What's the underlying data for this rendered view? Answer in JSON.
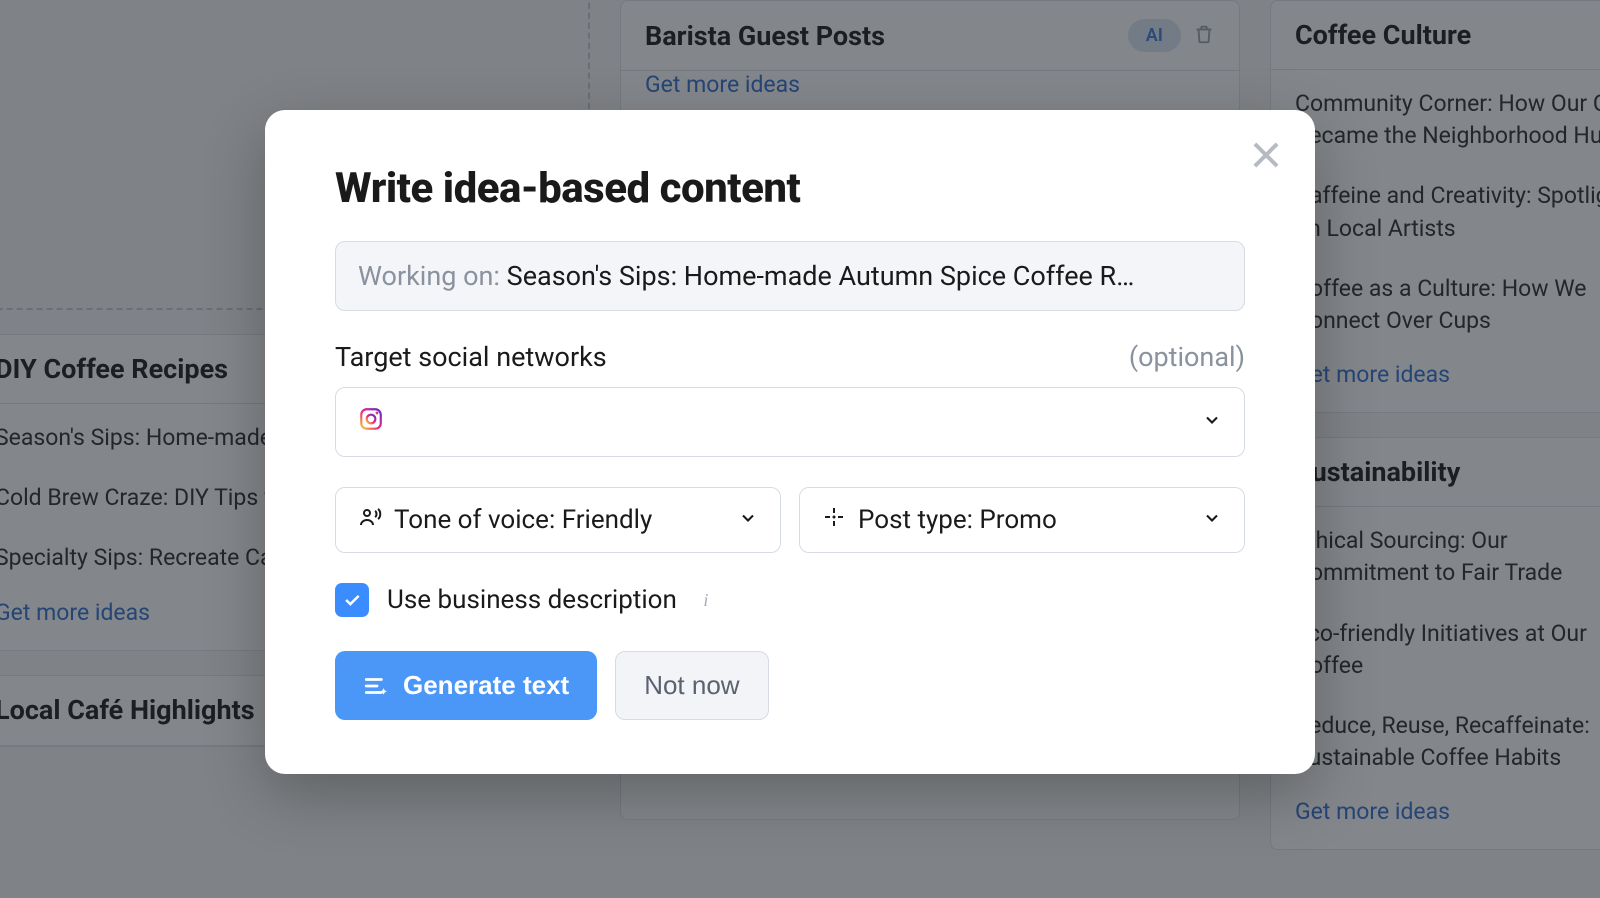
{
  "board": {
    "columns": [
      {
        "title": "DIY Coffee Recipes",
        "ai": false,
        "items": [
          "Season's Sips: Home-made Autumn Spice Coffee R",
          "Cold Brew Craze: DIY Tips for the Perfect Chill",
          "Specialty Sips: Recreate Café Favorites at Home"
        ],
        "more": "Get more ideas"
      },
      {
        "title": "Local Café Highlights",
        "ai": true,
        "items": [],
        "more": ""
      },
      {
        "title": "Barista Guest Posts",
        "ai": true,
        "items": [],
        "more": "Get more ideas"
      },
      {
        "title": "Coffee Culture",
        "ai": false,
        "items": [
          "Community Corner: How Our Café Became the Neighborhood Hub",
          "Caffeine and Creativity: Spotlight on Local Artists",
          "Coffee as a Culture: How We Connect Over Cups"
        ],
        "more": "Get more ideas"
      },
      {
        "title": "Sustainability",
        "ai": false,
        "items": [
          "Ethical Sourcing: Our Commitment to Fair Trade",
          "Eco-friendly Initiatives at Our Coffee",
          "Reduce, Reuse, Recaffeinate: Sustainable Coffee Habits"
        ],
        "more": "Get more ideas"
      }
    ]
  },
  "modal": {
    "title": "Write idea-based content",
    "working_prefix": "Working on: ",
    "working_value": "Season's Sips: Home-made Autumn Spice Coffee R…",
    "networks_label": "Target social networks",
    "optional": "(optional)",
    "tone_label": "Tone of voice: Friendly",
    "post_type_label": "Post type: Promo",
    "use_biz": "Use business description",
    "generate": "Generate text",
    "not_now": "Not now"
  }
}
